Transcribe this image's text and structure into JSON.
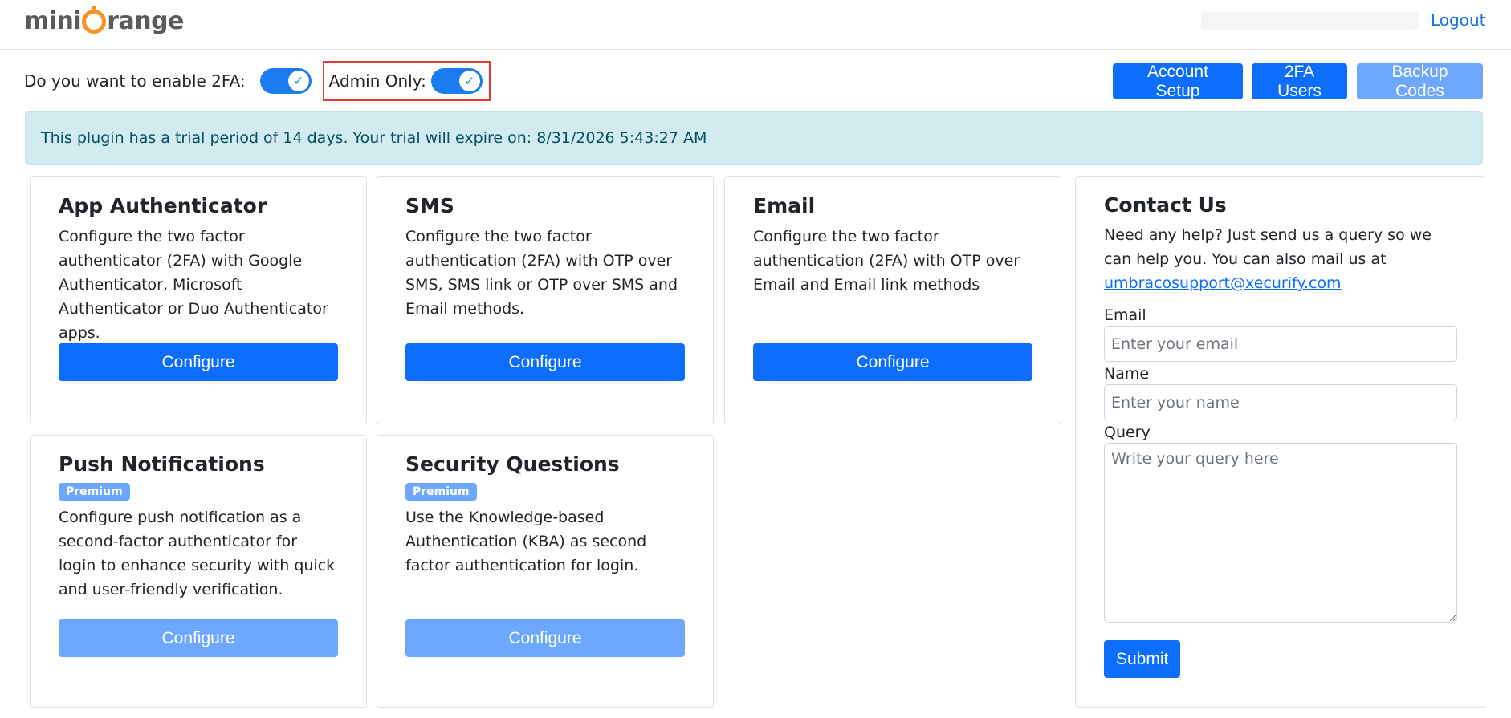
{
  "header": {
    "logo_left": "mini",
    "logo_right": "range",
    "logout_label": "Logout"
  },
  "toggles": {
    "enable_2fa_label": "Do you want to enable 2FA:",
    "enable_2fa_on": true,
    "admin_only_label": "Admin Only:",
    "admin_only_on": true
  },
  "toolbar": {
    "account_setup_label": "Account Setup",
    "users_label": "2FA Users",
    "backup_codes_label": "Backup Codes"
  },
  "alert": {
    "text": "This plugin has a trial period of 14 days. Your trial will expire on: 8/31/2026 5:43:27 AM"
  },
  "methods": [
    {
      "title": "App Authenticator",
      "description": "Configure the two factor authenticator (2FA) with Google Authenticator, Microsoft Authenticator or Duo Authenticator apps.",
      "badge": "",
      "button": "Configure",
      "premium": false
    },
    {
      "title": "SMS",
      "description": "Configure the two factor authentication (2FA) with OTP over SMS, SMS link or OTP over SMS and Email methods.",
      "badge": "",
      "button": "Configure",
      "premium": false
    },
    {
      "title": "Email",
      "description": "Configure the two factor authentication (2FA) with OTP over Email and Email link methods",
      "badge": "",
      "button": "Configure",
      "premium": false
    },
    {
      "title": "Push Notifications",
      "description": "Configure push notification as a second-factor authenticator for login to enhance security with quick and user-friendly verification.",
      "badge": "Premium",
      "button": "Configure",
      "premium": true
    },
    {
      "title": "Security Questions",
      "description": "Use the Knowledge-based Authentication (KBA) as second factor authentication for login.",
      "badge": "Premium",
      "button": "Configure",
      "premium": true
    }
  ],
  "contact": {
    "title": "Contact Us",
    "text": "Need any help? Just send us a query so we can help you. You can also mail us at",
    "email_link": "umbracosupport@xecurify.com",
    "email_label": "Email",
    "email_placeholder": "Enter your email",
    "name_label": "Name",
    "name_placeholder": "Enter your name",
    "query_label": "Query",
    "query_placeholder": "Write your query here",
    "submit_label": "Submit"
  },
  "colors": {
    "primary": "#0d6efd",
    "primary_disabled": "#6ea8fe",
    "alert_bg": "#d1ebef",
    "alert_text": "#055160",
    "highlight_border": "#e53935",
    "logo_accent": "#f7931e"
  }
}
